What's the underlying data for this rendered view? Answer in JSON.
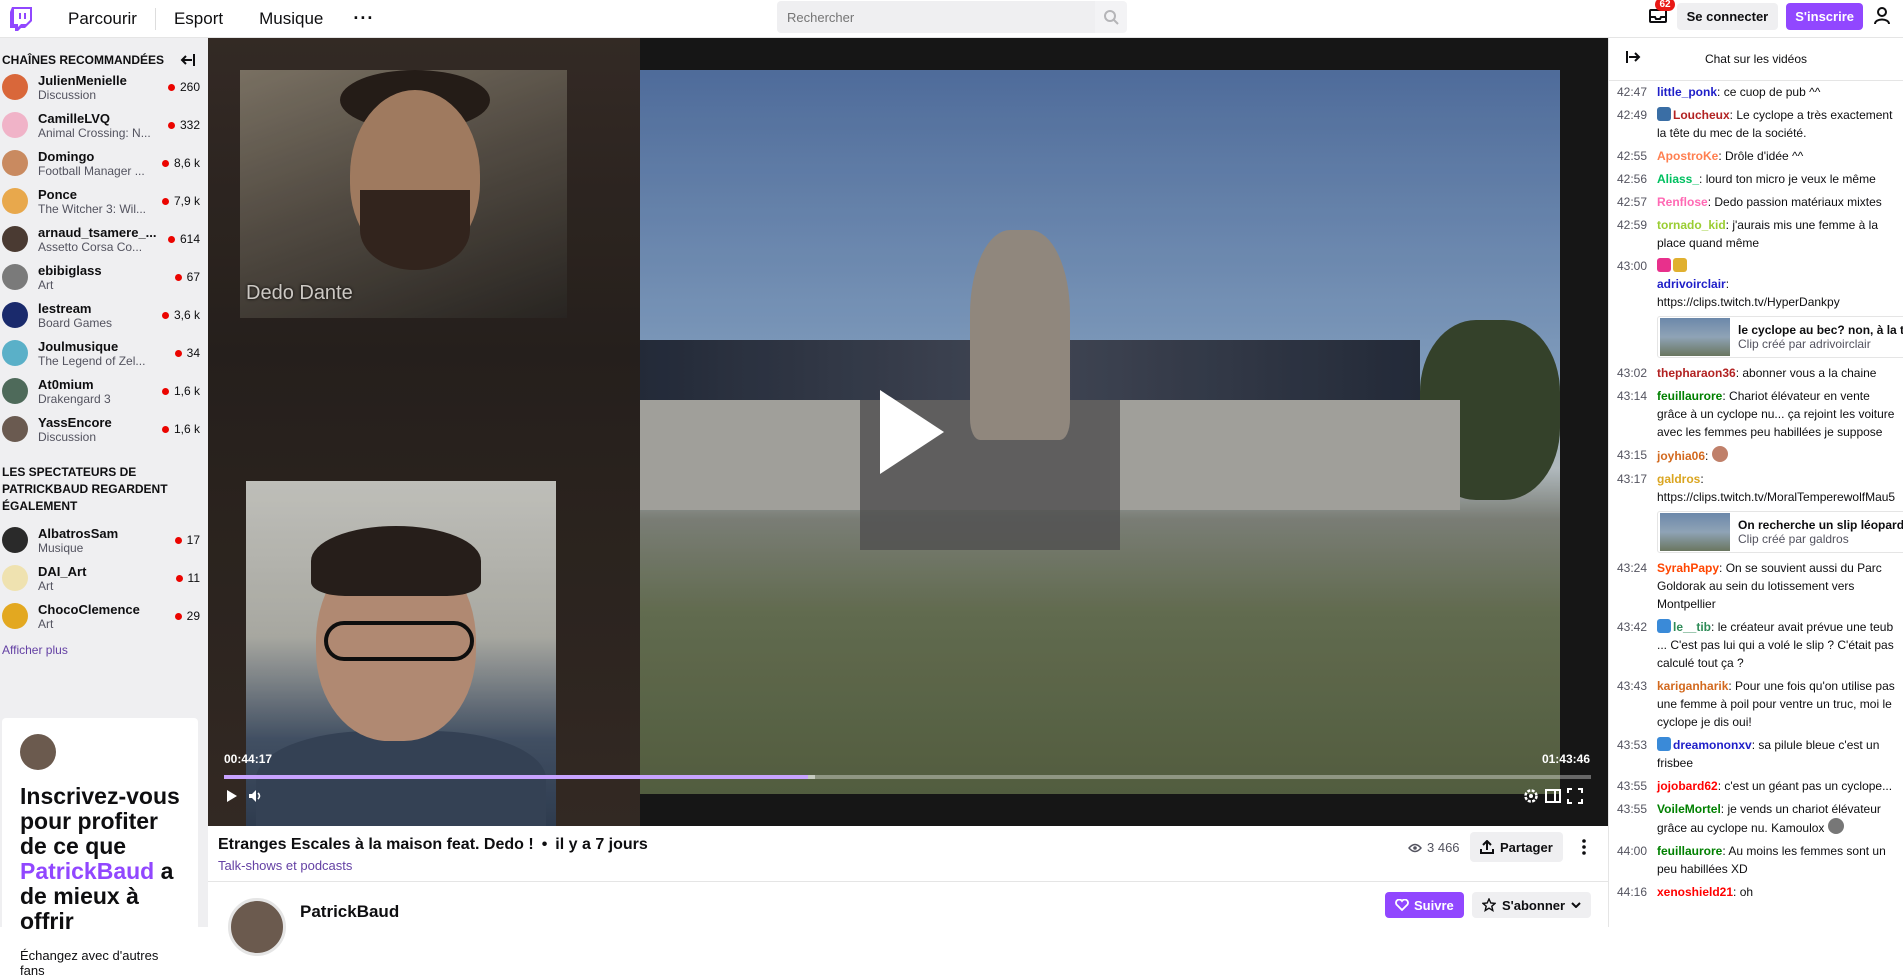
{
  "nav": {
    "links": [
      "Parcourir",
      "Esport",
      "Musique"
    ],
    "more": "···",
    "search_placeholder": "Rechercher",
    "inbox_badge": "62",
    "login": "Se connecter",
    "signup": "S'inscrire"
  },
  "sidebar": {
    "recommended_title": "CHAÎNES RECOMMANDÉES",
    "channels": [
      {
        "name": "JulienMenielle",
        "game": "Discussion",
        "viewers": "260",
        "color": "#d9673a"
      },
      {
        "name": "CamilleLVQ",
        "game": "Animal Crossing: N...",
        "viewers": "332",
        "color": "#f0b3c8"
      },
      {
        "name": "Domingo",
        "game": "Football Manager ...",
        "viewers": "8,6 k",
        "color": "#c98a60"
      },
      {
        "name": "Ponce",
        "game": "The Witcher 3: Wil...",
        "viewers": "7,9 k",
        "color": "#e8a84c"
      },
      {
        "name": "arnaud_tsamere_...",
        "game": "Assetto Corsa Co...",
        "viewers": "614",
        "color": "#4a3a32"
      },
      {
        "name": "ebibiglass",
        "game": "Art",
        "viewers": "67",
        "color": "#7a7a7a"
      },
      {
        "name": "lestream",
        "game": "Board Games",
        "viewers": "3,6 k",
        "color": "#1a2a6c"
      },
      {
        "name": "Joulmusique",
        "game": "The Legend of Zel...",
        "viewers": "34",
        "color": "#5ab0c8"
      },
      {
        "name": "At0mium",
        "game": "Drakengard 3",
        "viewers": "1,6 k",
        "color": "#4e6a5a"
      },
      {
        "name": "YassEncore",
        "game": "Discussion",
        "viewers": "1,6 k",
        "color": "#6a5a50"
      }
    ],
    "also_title": "LES SPECTATEURS DE PATRICKBAUD REGARDENT ÉGALEMENT",
    "also": [
      {
        "name": "AlbatrosSam",
        "game": "Musique",
        "viewers": "17",
        "color": "#2a2a2a"
      },
      {
        "name": "DAI_Art",
        "game": "Art",
        "viewers": "11",
        "color": "#efe2b0"
      },
      {
        "name": "ChocoClemence",
        "game": "Art",
        "viewers": "29",
        "color": "#e3a820"
      }
    ],
    "show_more": "Afficher plus",
    "promo": {
      "title_before": "Inscrivez-vous pour profiter de ce que ",
      "highlight": "PatrickBaud",
      "title_after": " a de mieux à offrir",
      "subtitle": "Échangez avec d'autres fans"
    }
  },
  "video": {
    "cam_label": "Dedo Dante",
    "current_time": "00:44:17",
    "total_time": "01:43:46",
    "progress": 0.427,
    "buffered": 0.432
  },
  "info": {
    "title": "Etranges Escales à la maison feat. Dedo !",
    "separator": "•",
    "ago": "il y a 7 jours",
    "category": "Talk-shows et podcasts",
    "views": "3 466",
    "share": "Partager",
    "channel": "PatrickBaud",
    "follow": "Suivre",
    "subscribe": "S'abonner"
  },
  "chat": {
    "title": "Chat sur les vidéos",
    "messages": [
      {
        "ts": "42:47",
        "user": "little_ponk",
        "color": "#1e1ec8",
        "text": "ce cuop de pub ^^"
      },
      {
        "ts": "42:49",
        "user": "Loucheux",
        "color": "#b22222",
        "text": "Le cyclope a très exactement la tête du mec de la société.",
        "badge": "#3a6ea5"
      },
      {
        "ts": "42:55",
        "user": "ApostroKe",
        "color": "#ff7f50",
        "text": "Drôle d'idée ^^"
      },
      {
        "ts": "42:56",
        "user": "Aliass_",
        "color": "#00c060",
        "text": "lourd ton micro je veux le même"
      },
      {
        "ts": "42:57",
        "user": "Renflose",
        "color": "#ff69b4",
        "text": "Dedo passion matériaux mixtes"
      },
      {
        "ts": "42:59",
        "user": "tornado_kid",
        "color": "#9acd32",
        "text": "j'aurais mis une femme à la place quand même"
      },
      {
        "ts": "43:00",
        "user": "adrivoirclair",
        "color": "#1e1ec8",
        "text": "https://clips.twitch.tv/HyperDankpy",
        "badge": "#e8308c",
        "badge2": "#e0b030",
        "newline": true
      },
      {
        "ts": "43:02",
        "user": "thepharaon36",
        "color": "#b22222",
        "text": "abonner vous a la chaine"
      },
      {
        "ts": "43:14",
        "user": "feuillaurore",
        "color": "#008000",
        "text": "Chariot élévateur en vente grâce à un cyclope nu... ça rejoint les voiture avec les femmes peu habillées je suppose"
      },
      {
        "ts": "43:15",
        "user": "joyhia06",
        "color": "#d2691e",
        "text": "",
        "emote": "#c0806a"
      },
      {
        "ts": "43:17",
        "user": "galdros",
        "color": "#daa520",
        "text": "https://clips.twitch.tv/MoralTemperewolfMau5"
      },
      {
        "ts": "43:24",
        "user": "SyrahPapy",
        "color": "#ff4500",
        "text": "On se souvient aussi du Parc Goldorak au sein du lotissement vers Montpellier"
      },
      {
        "ts": "43:42",
        "user": "le__tib",
        "color": "#2e8b57",
        "text": "le créateur avait prévue une teub ... C'est pas lui qui a volé le slip ? C'était pas calculé tout ça ?",
        "badge": "#3a8ad8"
      },
      {
        "ts": "43:43",
        "user": "kariganharik",
        "color": "#d2691e",
        "text": "Pour une fois qu'on utilise pas une femme à poil pour ventre un truc, moi le cyclope je dis oui!"
      },
      {
        "ts": "43:53",
        "user": "dreamononxv",
        "color": "#1e1ec8",
        "text": "sa pilule bleue c'est un frisbee",
        "badge": "#3a8ad8"
      },
      {
        "ts": "43:55",
        "user": "jojobard62",
        "color": "#ff0000",
        "text": "c'est un géant pas un cyclope..."
      },
      {
        "ts": "43:55",
        "user": "VoileMortel",
        "color": "#008000",
        "text": "je vends un chariot élévateur grâce au cyclope nu. Kamoulox",
        "emote": "#777"
      },
      {
        "ts": "44:00",
        "user": "feuillaurore",
        "color": "#008000",
        "text": "Au moins les femmes sont un peu habillées XD"
      },
      {
        "ts": "44:16",
        "user": "xenoshield21",
        "color": "#ff0000",
        "text": "oh"
      }
    ],
    "clips": [
      {
        "title": "le cyclope au bec? non, à la t",
        "sub": "Clip créé par adrivoirclair"
      },
      {
        "title": "On recherche un slip léopard",
        "sub": "Clip créé par galdros"
      }
    ]
  }
}
